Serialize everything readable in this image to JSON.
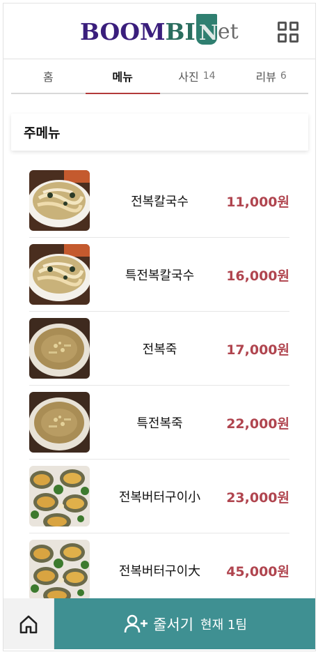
{
  "header": {
    "logo_text": "BOOMBINet",
    "logo_part_boom": "BOOM",
    "logo_part_bi": "BI",
    "logo_part_n": "N",
    "logo_part_et": "et",
    "menu_icon": "grid-icon"
  },
  "tabs": [
    {
      "label": "홈",
      "count": ""
    },
    {
      "label": "메뉴",
      "count": ""
    },
    {
      "label": "사진",
      "count": "14"
    },
    {
      "label": "리뷰",
      "count": "6"
    }
  ],
  "section": {
    "title": "주메뉴"
  },
  "menu_items": [
    {
      "name": "전복칼국수",
      "price": "11,000원",
      "image": "noodle-soup-image"
    },
    {
      "name": "특전복칼국수",
      "price": "16,000원",
      "image": "noodle-soup-image"
    },
    {
      "name": "전복죽",
      "price": "17,000원",
      "image": "porridge-image"
    },
    {
      "name": "특전복죽",
      "price": "22,000원",
      "image": "porridge-image"
    },
    {
      "name": "전복버터구이小",
      "price": "23,000원",
      "image": "grilled-abalone-image"
    },
    {
      "name": "전복버터구이大",
      "price": "45,000원",
      "image": "grilled-abalone-image"
    }
  ],
  "bottom_bar": {
    "home_icon": "home-icon",
    "queue_icon": "add-user-icon",
    "queue_label": "줄서기",
    "queue_status": "현재 1팀"
  },
  "colors": {
    "accent_teal": "#3f9092",
    "price_red": "#b0454f",
    "tab_underline": "#b33a3a",
    "logo_purple": "#3a1e7c",
    "logo_green": "#2f7f70"
  }
}
